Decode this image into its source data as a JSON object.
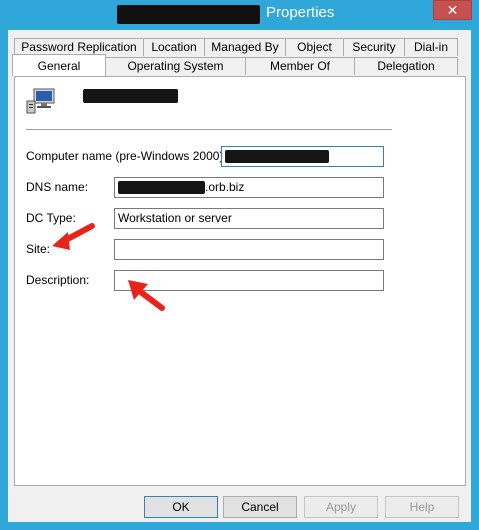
{
  "window": {
    "title": "Properties",
    "close_glyph": "✕"
  },
  "tabs_back": [
    {
      "label": "Password Replication"
    },
    {
      "label": "Location"
    },
    {
      "label": "Managed By"
    },
    {
      "label": "Object"
    },
    {
      "label": "Security"
    },
    {
      "label": "Dial-in"
    }
  ],
  "tabs_front": [
    {
      "label": "General"
    },
    {
      "label": "Operating System"
    },
    {
      "label": "Member Of"
    },
    {
      "label": "Delegation"
    }
  ],
  "general": {
    "icon": "computer-icon",
    "fields": {
      "computer_name_label": "Computer name (pre-Windows 2000):",
      "dns_name_label": "DNS name:",
      "dns_name_suffix": ".orb.biz",
      "dc_type_label": "DC Type:",
      "dc_type_value": "Workstation or server",
      "site_label": "Site:",
      "site_value": "",
      "description_label": "Description:",
      "description_value": ""
    }
  },
  "buttons": {
    "ok": "OK",
    "cancel": "Cancel",
    "apply": "Apply",
    "help": "Help"
  },
  "colors": {
    "title_bar": "#2fa7d9",
    "close_button": "#c75050",
    "annotation_arrow": "#e8231a"
  }
}
